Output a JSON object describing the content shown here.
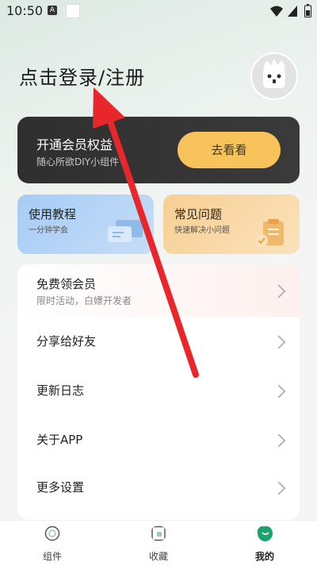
{
  "status": {
    "time": "10:50",
    "notif_icon": "A"
  },
  "header": {
    "login_label": "点击登录/注册",
    "avatar_icon": "cat-face-icon"
  },
  "vip": {
    "title": "开通会员权益",
    "subtitle": "随心所欲DIY小组件",
    "button": "去看看"
  },
  "features": [
    {
      "title": "使用教程",
      "subtitle": "一分钟学会",
      "icon": "chat-bubbles-icon"
    },
    {
      "title": "常见问题",
      "subtitle": "快速解决小问题",
      "icon": "clipboard-check-icon"
    }
  ],
  "menu": {
    "free_vip": {
      "label": "免费领会员",
      "subtitle": "限时活动，白嫖开发者"
    },
    "items": [
      "分享给好友",
      "更新日志",
      "关于APP",
      "更多设置"
    ]
  },
  "nav": [
    {
      "label": "组件",
      "icon": "widget-icon"
    },
    {
      "label": "收藏",
      "icon": "favorite-icon"
    },
    {
      "label": "我的",
      "icon": "profile-smile-icon",
      "active": true
    }
  ],
  "colors": {
    "accent": "#1aa36f",
    "vip_button": "#f9c35b",
    "annotation_arrow": "#e8272c"
  }
}
